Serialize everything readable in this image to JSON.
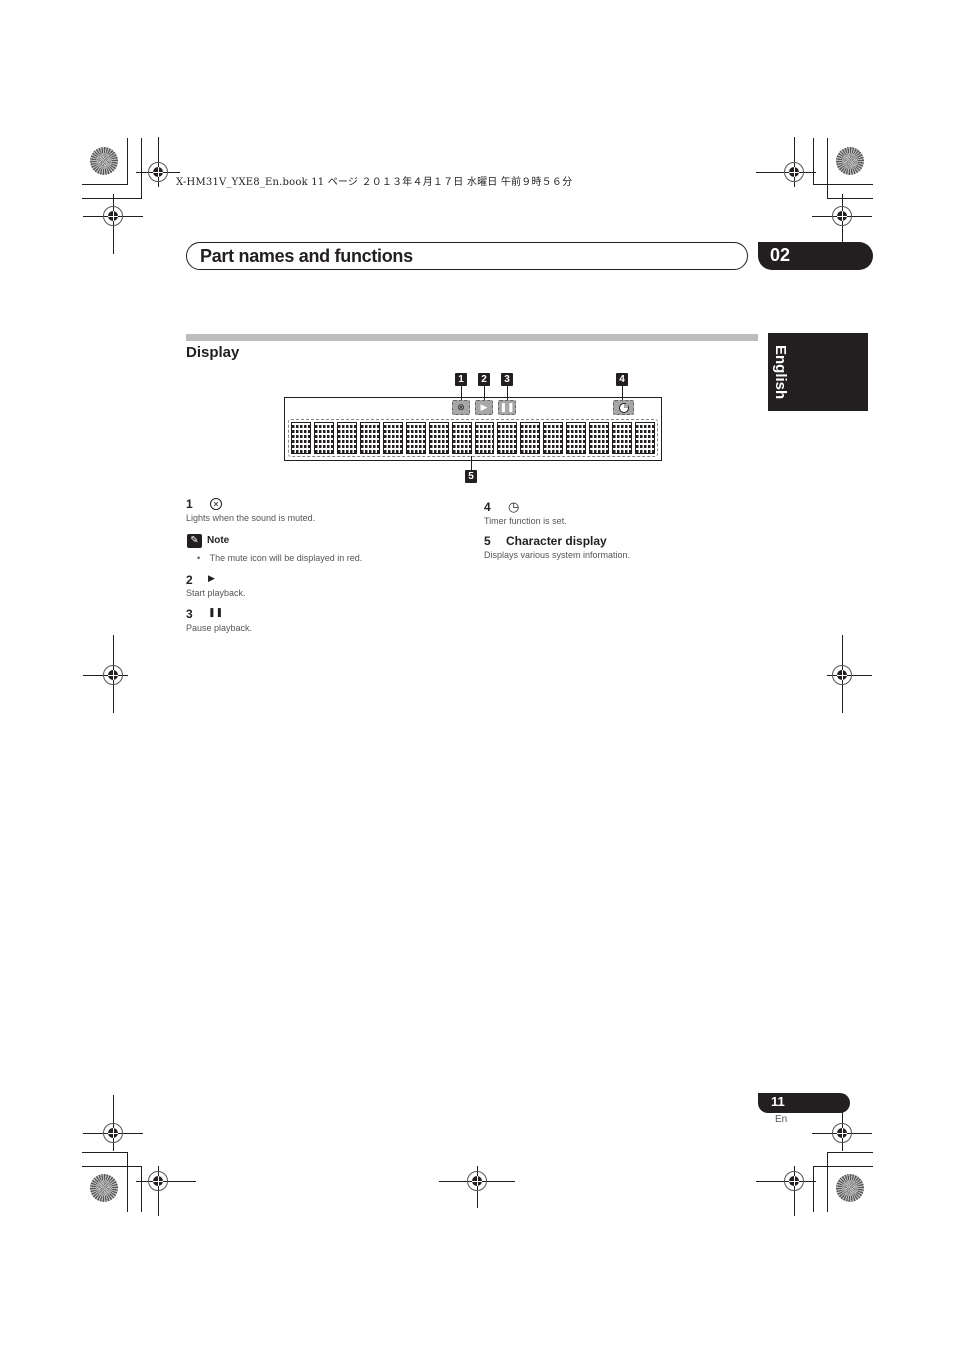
{
  "print_header": {
    "file_info": "X-HM31V_YXE8_En.book  11 ページ  ２０１３年４月１７日  水曜日  午前９時５６分"
  },
  "header": {
    "title": "Part names and functions",
    "chapter_number": "02"
  },
  "side_tab": {
    "language": "English"
  },
  "section": {
    "title": "Display"
  },
  "diagram": {
    "callouts": [
      "1",
      "2",
      "3",
      "4",
      "5"
    ],
    "indicators": [
      {
        "id": "1",
        "icon": "mute-icon",
        "glyph": "⊗"
      },
      {
        "id": "2",
        "icon": "play-icon",
        "glyph": "▶"
      },
      {
        "id": "3",
        "icon": "pause-icon",
        "glyph": "❚❚"
      },
      {
        "id": "4",
        "icon": "timer-icon",
        "glyph": "◔"
      }
    ],
    "character_cells": 16
  },
  "items": [
    {
      "number": "1",
      "icon": "mute-icon",
      "glyph": "⊗",
      "title": "",
      "description": "Lights when the sound is muted."
    },
    {
      "number": "2",
      "icon": "play-icon",
      "glyph": "▶",
      "title": "",
      "description": "Start playback."
    },
    {
      "number": "3",
      "icon": "pause-icon",
      "glyph": "❚❚",
      "title": "",
      "description": "Pause playback."
    },
    {
      "number": "4",
      "icon": "timer-icon",
      "glyph": "◷",
      "title": "",
      "description": "Timer function is set."
    },
    {
      "number": "5",
      "icon": "",
      "glyph": "",
      "title": "Character display",
      "description": "Displays various system information."
    }
  ],
  "note": {
    "label": "Note",
    "icon": "pencil-icon",
    "bullets": [
      "The mute icon will be displayed in red."
    ],
    "bullet_glyph": "•"
  },
  "footer": {
    "page_number": "11",
    "language_code": "En"
  }
}
